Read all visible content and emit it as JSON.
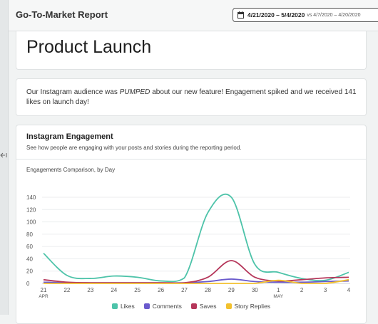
{
  "header": {
    "report_title": "Go-To-Market Report",
    "date_range": "4/21/2020 – 5/4/2020",
    "compare_range": "vs 4/7/2020 – 4/20/2020"
  },
  "page_title": "Product Launch",
  "note": {
    "before": "Our Instagram audience was ",
    "emphasis": "PUMPED",
    "after": " about our new feature! Engagement spiked and we received 141 likes on launch day!"
  },
  "section": {
    "title": "Instagram Engagement",
    "subtitle": "See how people are engaging with your posts and stories during the reporting period.",
    "chart_label": "Engagements Comparison, by Day"
  },
  "chart_data": {
    "type": "line",
    "x": [
      "21",
      "22",
      "23",
      "24",
      "25",
      "26",
      "27",
      "28",
      "29",
      "30",
      "1",
      "2",
      "3",
      "4"
    ],
    "x_sublabels": {
      "21": "APR",
      "1": "MAY"
    },
    "ylim": [
      0,
      140
    ],
    "yticks": [
      0,
      20,
      40,
      60,
      80,
      100,
      120,
      140
    ],
    "grid": true,
    "legend_position": "bottom",
    "series": [
      {
        "name": "Likes",
        "color": "#4dc3a9",
        "values": [
          49,
          13,
          8,
          12,
          10,
          4,
          9,
          115,
          140,
          31,
          18,
          8,
          5,
          18
        ]
      },
      {
        "name": "Comments",
        "color": "#6a5acd",
        "values": [
          2,
          1,
          1,
          1,
          1,
          1,
          1,
          3,
          7,
          3,
          2,
          2,
          3,
          4
        ]
      },
      {
        "name": "Saves",
        "color": "#b5365a",
        "values": [
          6,
          2,
          1,
          1,
          1,
          1,
          1,
          10,
          37,
          10,
          4,
          6,
          9,
          10
        ]
      },
      {
        "name": "Story Replies",
        "color": "#f2c12e",
        "values": [
          0,
          0,
          0,
          0,
          0,
          0,
          0,
          0,
          0,
          0,
          5,
          0,
          0,
          6
        ]
      }
    ]
  }
}
